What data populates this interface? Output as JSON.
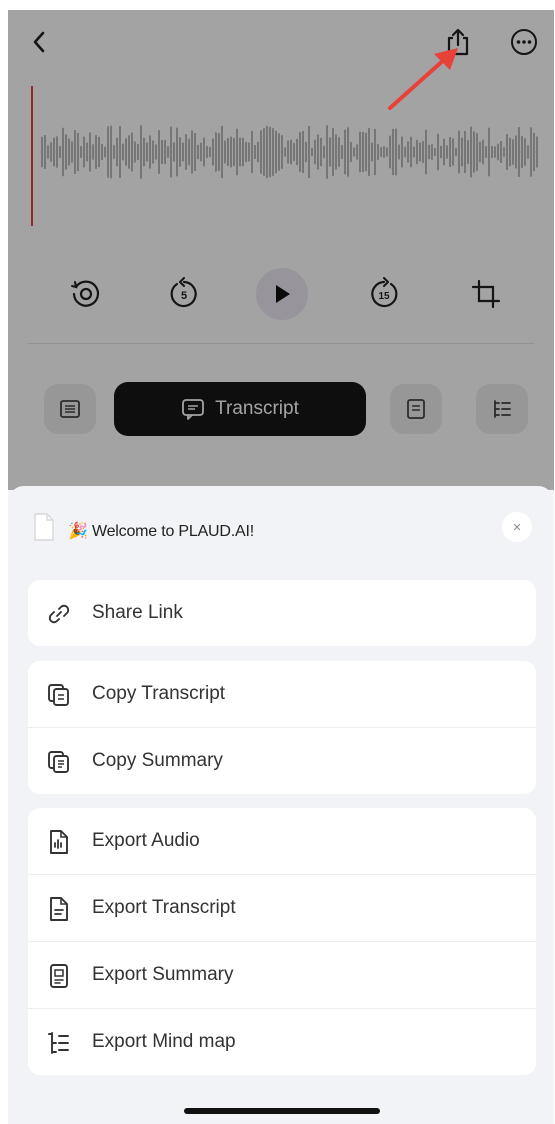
{
  "player": {
    "tabs": {
      "active_label": "Transcript"
    }
  },
  "sheet": {
    "title_emoji": "🎉",
    "title": "Welcome to PLAUD.AI!",
    "close_glyph": "×",
    "groups": [
      {
        "items": [
          {
            "label": "Share Link",
            "icon": "link-icon"
          }
        ]
      },
      {
        "items": [
          {
            "label": "Copy Transcript",
            "icon": "copy-icon"
          },
          {
            "label": "Copy Summary",
            "icon": "copy-icon"
          }
        ]
      },
      {
        "items": [
          {
            "label": "Export Audio",
            "icon": "audio-file-icon"
          },
          {
            "label": "Export Transcript",
            "icon": "document-icon"
          },
          {
            "label": "Export Summary",
            "icon": "summary-file-icon"
          },
          {
            "label": "Export Mind map",
            "icon": "mind-map-icon"
          }
        ]
      }
    ]
  },
  "colors": {
    "accent_red": "#e8413a",
    "active_tab_bg": "#161616",
    "waveform": "#9a9a9a",
    "sheet_bg": "#f2f3f6"
  }
}
